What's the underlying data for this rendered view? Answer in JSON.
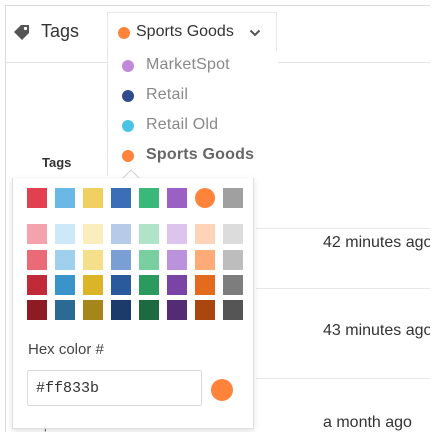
{
  "header": {
    "title": "Tags",
    "icon": "tag-icon",
    "dropdown": {
      "selected_label": "Sports Goods",
      "selected_color": "#ff833b"
    }
  },
  "tag_menu": [
    {
      "label": "MarketSpot",
      "color": "#c08ad8"
    },
    {
      "label": "Retail",
      "color": "#2e4e8c"
    },
    {
      "label": "Retail Old",
      "color": "#4cc3e6"
    },
    {
      "label": "Sports Goods",
      "color": "#ff833b",
      "selected": true
    }
  ],
  "table": {
    "column_header": "Tags",
    "rows": [
      {
        "time": "42 minutes ago"
      },
      {
        "time": "43 minutes ago"
      },
      {
        "time": "a month ago"
      }
    ],
    "partial_text": "Sports Goods"
  },
  "color_picker": {
    "primary_colors": [
      "#e23f4f",
      "#6ab8e6",
      "#f0d060",
      "#3a6fb8",
      "#3ab879",
      "#9a60c4",
      "#ff833b",
      "#a0a0a0"
    ],
    "selected_index": 6,
    "shade_rows": [
      [
        "#f4a3ad",
        "#cde8f7",
        "#fbeebd",
        "#b6cbe8",
        "#b0e4c8",
        "#dcc4ec",
        "#ffd3b8",
        "#dcdcdc"
      ],
      [
        "#ea6a78",
        "#9fd1ef",
        "#f5df8a",
        "#7a9fd4",
        "#79cfa0",
        "#bb92dc",
        "#ffab78",
        "#bdbdbd"
      ],
      [
        "#c12a38",
        "#3a94c9",
        "#dbb428",
        "#2b5a9c",
        "#2a9a5e",
        "#7a44a6",
        "#e46a1d",
        "#7d7d7d"
      ],
      [
        "#8e1a25",
        "#2b6a92",
        "#a6861a",
        "#1c3a6a",
        "#1d6a40",
        "#532c74",
        "#a9470e",
        "#555555"
      ]
    ],
    "hex_label": "Hex color #",
    "hex_value": "#ff833b",
    "preview_color": "#ff833b"
  }
}
